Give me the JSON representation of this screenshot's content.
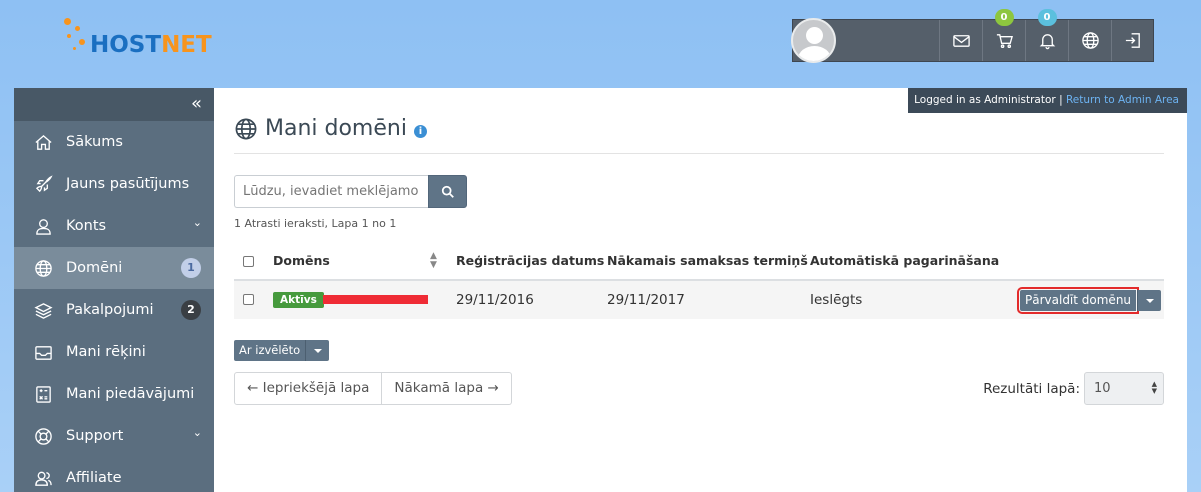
{
  "brand": {
    "logo_part1": "HOST",
    "logo_part2": "NET",
    "logo_primary": "#1a6fc1",
    "logo_accent": "#f7941d"
  },
  "header": {
    "cart_count": "0",
    "notifications_count": "0",
    "icons": [
      "envelope-icon",
      "cart-icon",
      "bell-icon",
      "globe-icon",
      "logout-icon"
    ],
    "badge_colors": {
      "cart": "#8dc63f",
      "notifications": "#5bc0de"
    }
  },
  "admin_bar": {
    "logged_in_text": "Logged in as Administrator",
    "separator": "|",
    "return_link": "Return to Admin Area"
  },
  "sidebar": {
    "collapse_glyph": "«",
    "items": [
      {
        "label": "Sākums",
        "icon": "home-icon"
      },
      {
        "label": "Jauns pasūtījums",
        "icon": "rocket-icon"
      },
      {
        "label": "Konts",
        "icon": "user-icon",
        "has_submenu": true
      },
      {
        "label": "Domēni",
        "icon": "globe-icon",
        "badge": "1",
        "active": true
      },
      {
        "label": "Pakalpojumi",
        "icon": "layers-icon",
        "badge": "2"
      },
      {
        "label": "Mani rēķini",
        "icon": "inbox-icon"
      },
      {
        "label": "Mani piedāvājumi",
        "icon": "calculator-icon"
      },
      {
        "label": "Support",
        "icon": "lifebuoy-icon",
        "has_submenu": true
      },
      {
        "label": "Affiliate",
        "icon": "users-icon"
      }
    ]
  },
  "page": {
    "title": "Mani domēni",
    "info_glyph": "i",
    "search_placeholder": "Lūdzu, ievadiet meklējamo",
    "record_info": "1 Atrasti ieraksti, Lapa 1 no 1"
  },
  "table": {
    "columns": [
      "Domēns",
      "Reģistrācijas datums",
      "Nākamais samaksas termiņš",
      "Automātiskā pagarināšana"
    ],
    "rows": [
      {
        "status": "Aktīvs",
        "domain_redacted": true,
        "registration_date": "29/11/2016",
        "next_due": "29/11/2017",
        "auto_renew": "Ieslēgts",
        "manage_label": "Pārvaldīt domēnu"
      }
    ]
  },
  "bulk_action_label": "Ar izvēlēto",
  "pagination": {
    "prev_label": "← Iepriekšējā lapa",
    "next_label": "Nākamā lapa →"
  },
  "per_page": {
    "label": "Rezultāti lapā:",
    "value": "10"
  }
}
